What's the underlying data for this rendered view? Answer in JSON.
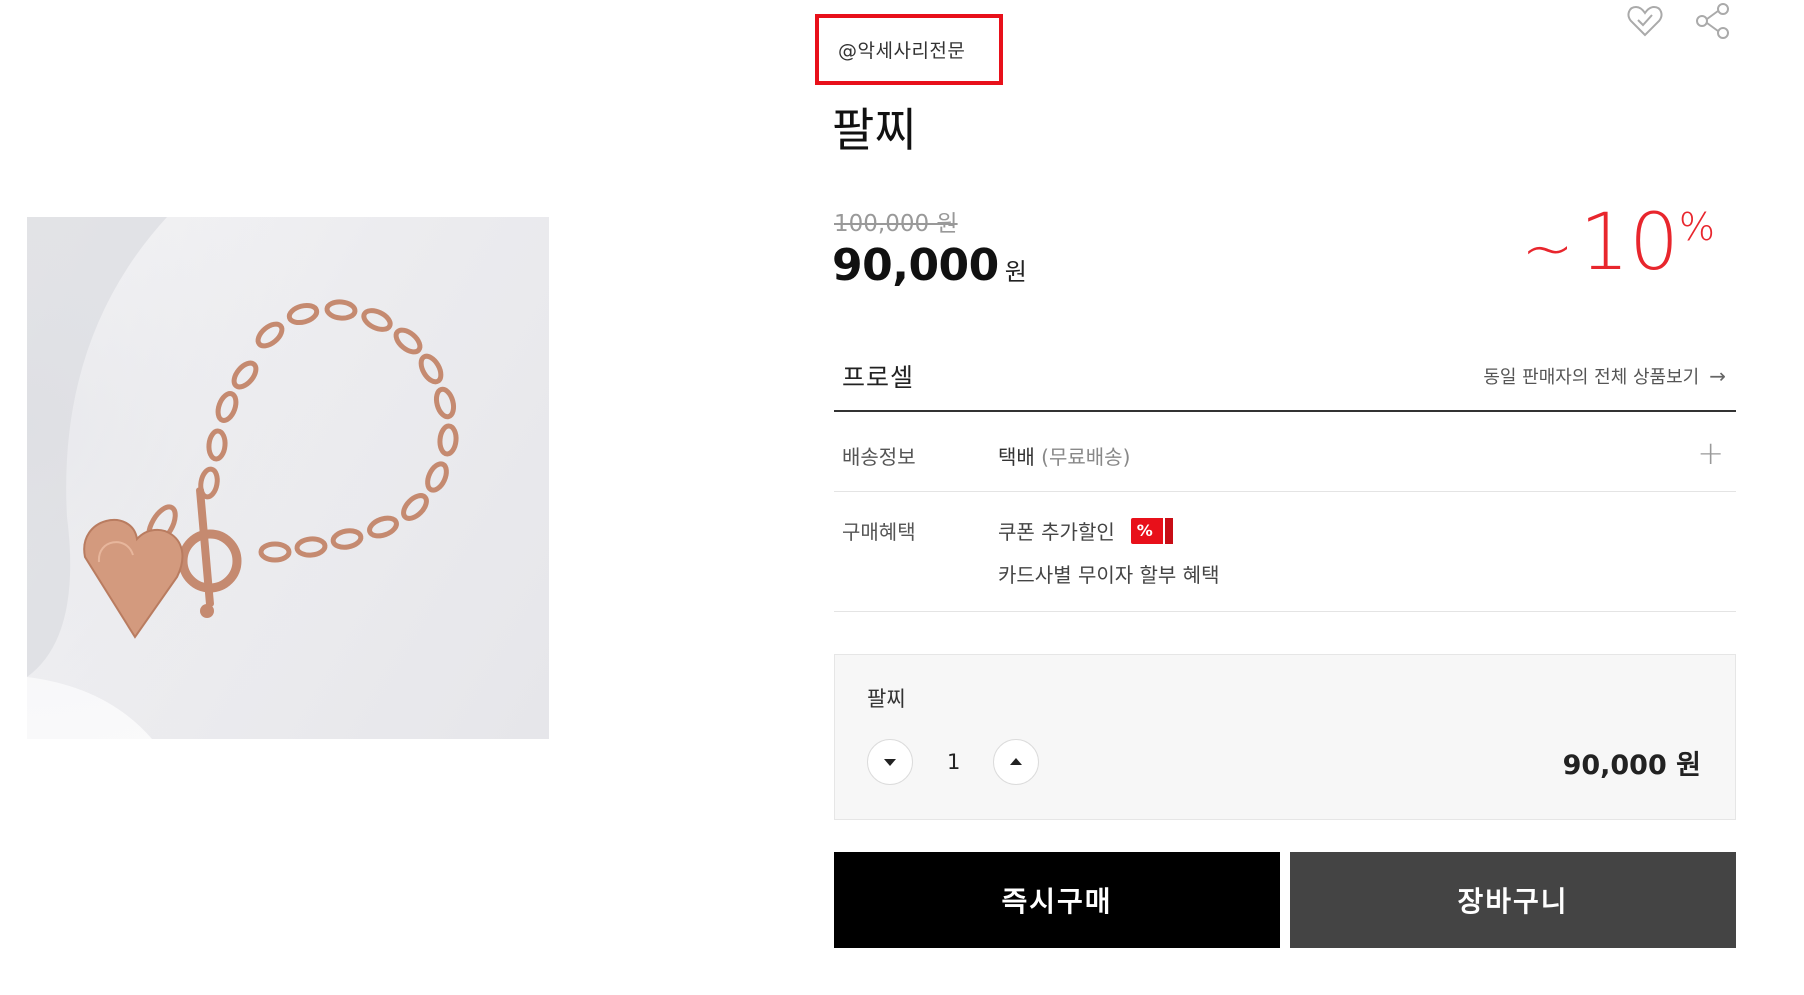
{
  "seller_tag": "@악세사리전문",
  "product": {
    "name": "팔찌",
    "original_price": "100,000 원",
    "sale_price": "90,000",
    "currency": "원",
    "discount": {
      "tilde": "~",
      "value": "10",
      "percent": "%"
    }
  },
  "icons": {
    "wishlist": "heart-check-icon",
    "share": "share-icon"
  },
  "brand": {
    "name": "프로셀",
    "see_all": "동일 판매자의 전체 상품보기",
    "arrow": "→"
  },
  "delivery": {
    "label": "배송정보",
    "method": "택배",
    "detail": "(무료배송)"
  },
  "benefit": {
    "label": "구매혜택",
    "coupon": "쿠폰 추가할인",
    "coupon_badge": "%",
    "installment": "카드사별 무이자 할부 혜택"
  },
  "option": {
    "name": "팔찌",
    "quantity": "1",
    "price": "90,000 원"
  },
  "buttons": {
    "buy_now": "즉시구매",
    "cart": "장바구니"
  },
  "colors": {
    "accent_red": "#e8262d",
    "buy_button": "#000000",
    "cart_button": "#444444"
  }
}
